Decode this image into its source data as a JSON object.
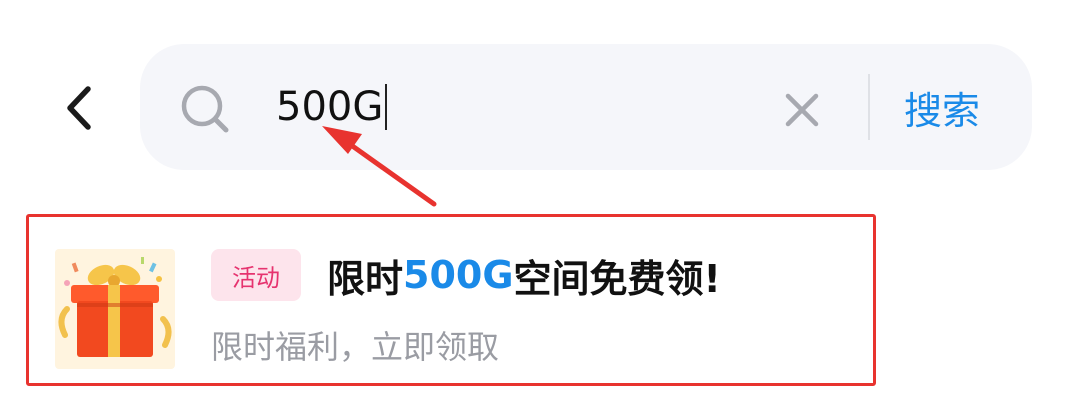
{
  "header": {
    "back_icon": "chevron-left-icon"
  },
  "search": {
    "icon": "search-icon",
    "value": "500G",
    "clear_icon": "close-icon",
    "button_label": "搜索"
  },
  "colors": {
    "accent": "#1a8ae8",
    "annotation_red": "#e8332f",
    "badge_text": "#e6336f",
    "badge_bg": "#fde4ec",
    "search_bg": "#f5f6fa"
  },
  "result": {
    "thumbnail_icon": "gift-box-icon",
    "badge": "活动",
    "title_prefix": "限时",
    "title_highlight": "500G",
    "title_suffix": "空间免费领!",
    "subtitle": "限时福利，立即领取"
  }
}
